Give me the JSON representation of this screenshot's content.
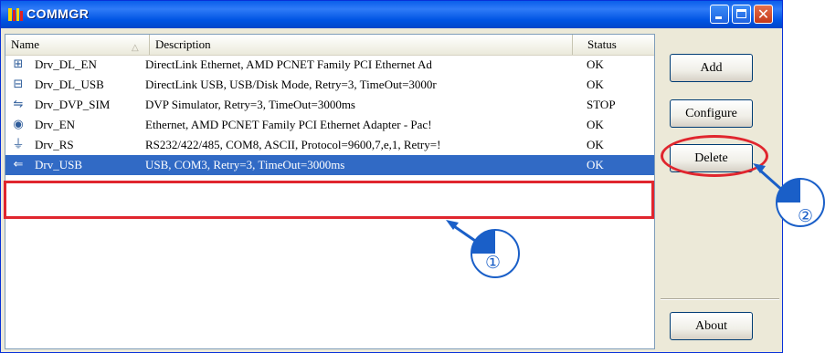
{
  "window": {
    "title": "COMMGR"
  },
  "titlebar_buttons": {
    "minimize_icon": "minimize-icon",
    "maximize_icon": "maximize-icon",
    "close_glyph": "✕"
  },
  "list": {
    "columns": [
      "Name",
      "Description",
      "Status"
    ],
    "sort_indicator": "△",
    "rows": [
      {
        "icon": "⊞",
        "name": "Drv_DL_EN",
        "description": "DirectLink Ethernet, AMD PCNET Family PCI Ethernet Ad",
        "status": "OK"
      },
      {
        "icon": "⊟",
        "name": "Drv_DL_USB",
        "description": "DirectLink USB, USB/Disk Mode, Retry=3, TimeOut=3000r",
        "status": "OK"
      },
      {
        "icon": "⇋",
        "name": "Drv_DVP_SIM",
        "description": "DVP Simulator, Retry=3, TimeOut=3000ms",
        "status": "STOP"
      },
      {
        "icon": "◉",
        "name": "Drv_EN",
        "description": "Ethernet, AMD PCNET Family PCI Ethernet Adapter - Pac!",
        "status": "OK"
      },
      {
        "icon": "⏚",
        "name": "Drv_RS",
        "description": "RS232/422/485, COM8, ASCII, Protocol=9600,7,e,1, Retry=!",
        "status": "OK"
      },
      {
        "icon": "⇐",
        "name": "Drv_USB",
        "description": "USB, COM3, Retry=3, TimeOut=3000ms",
        "status": "OK"
      }
    ],
    "selected_index": 5
  },
  "buttons": {
    "add": "Add",
    "configure": "Configure",
    "delete": "Delete",
    "about": "About"
  },
  "annotations": {
    "step1": "①",
    "step2": "②"
  },
  "colors": {
    "title_bar": "#0054E3",
    "selection": "#316AC5",
    "annotation_red": "#E0262E",
    "annotation_blue": "#1A5FC8"
  }
}
